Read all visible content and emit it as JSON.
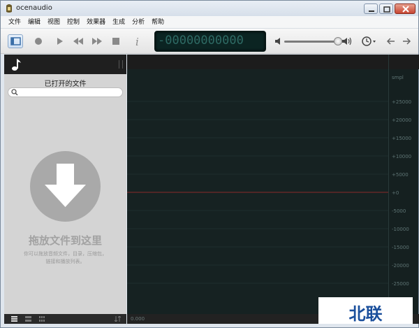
{
  "window": {
    "title": "ocenaudio"
  },
  "menu": [
    "文件",
    "编辑",
    "视图",
    "控制",
    "效果器",
    "生成",
    "分析",
    "帮助"
  ],
  "toolbar": {
    "time_display": "-00000000000",
    "buttons": [
      "sidebar-toggle",
      "record",
      "play",
      "rewind",
      "fast-forward",
      "stop",
      "info"
    ],
    "right_icons": [
      "volume-low-icon",
      "volume-high-icon",
      "clock-icon",
      "arrow-left-icon",
      "arrow-right-icon"
    ]
  },
  "sidebar": {
    "title": "已打开的文件",
    "search_placeholder": "",
    "drop_title": "拖放文件到这里",
    "drop_desc": "你可以拖放音频文件，目录，压缩包，链接和播放列表。"
  },
  "wave": {
    "footer_label": "0.000"
  },
  "scale": {
    "unit": "smpl",
    "ticks": [
      "+25000",
      "+20000",
      "+15000",
      "+10000",
      "+5000",
      "+0",
      "-5000",
      "-10000",
      "-15000",
      "-20000",
      "-25000"
    ]
  },
  "watermark": "北联",
  "colors": {
    "wave_bg": "#162222",
    "center_line": "#8a2b2b",
    "lcd_text": "#2e6a64"
  }
}
